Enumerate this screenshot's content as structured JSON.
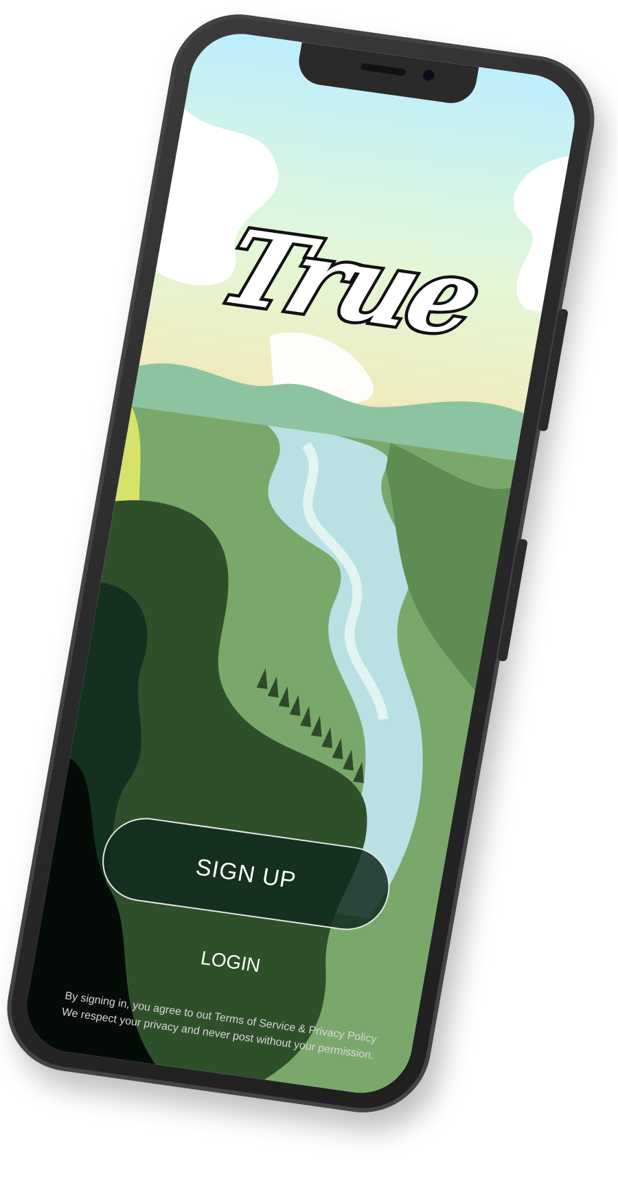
{
  "app": {
    "logo_text": "True"
  },
  "actions": {
    "signup_label": "SIGN UP",
    "login_label": "LOGIN"
  },
  "legal": {
    "terms_text": "By signing in, you agree to out Terms of Service & Privacy Policy We respect your privacy and never post without your permission."
  },
  "colors": {
    "sky": "#bfeefb",
    "forest_dark": "#102a1c",
    "meadow": "#7aa86a",
    "river": "#b9e1e3",
    "accent_yellow": "#e8ec6a"
  }
}
